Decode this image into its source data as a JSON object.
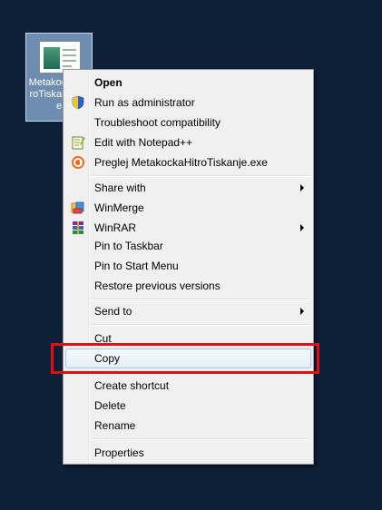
{
  "desktop": {
    "icon_label": "MetakockaHitroTiskanje.exe"
  },
  "menu": {
    "items": [
      {
        "label": "Open"
      },
      {
        "label": "Run as administrator"
      },
      {
        "label": "Troubleshoot compatibility"
      },
      {
        "label": "Edit with Notepad++"
      },
      {
        "label": "Preglej MetakockaHitroTiskanje.exe"
      },
      {
        "label": "Share with"
      },
      {
        "label": "WinMerge"
      },
      {
        "label": "WinRAR"
      },
      {
        "label": "Pin to Taskbar"
      },
      {
        "label": "Pin to Start Menu"
      },
      {
        "label": "Restore previous versions"
      },
      {
        "label": "Send to"
      },
      {
        "label": "Cut"
      },
      {
        "label": "Copy"
      },
      {
        "label": "Create shortcut"
      },
      {
        "label": "Delete"
      },
      {
        "label": "Rename"
      },
      {
        "label": "Properties"
      }
    ]
  },
  "colors": {
    "desktop_bg": "#0e1f38",
    "highlight_box": "#e01010"
  }
}
